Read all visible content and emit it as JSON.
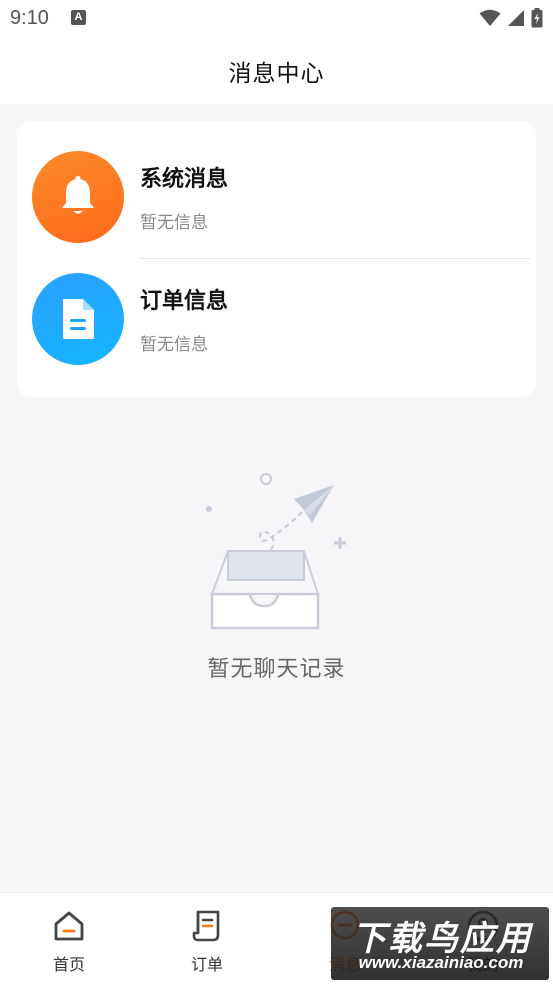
{
  "status_bar": {
    "time": "9:10",
    "notification_badge": "A",
    "icons": [
      "wifi-icon",
      "signal-icon",
      "battery-charging-icon"
    ]
  },
  "header": {
    "title": "消息中心"
  },
  "messages": [
    {
      "title": "系统消息",
      "subtitle": "暂无信息",
      "icon": "bell-icon",
      "color": "#fd7420"
    },
    {
      "title": "订单信息",
      "subtitle": "暂无信息",
      "icon": "document-icon",
      "color": "#1aa6ff"
    }
  ],
  "empty_state": {
    "text": "暂无聊天记录",
    "icon": "empty-inbox-paper-plane-icon"
  },
  "bottom_nav": {
    "items": [
      {
        "label": "首页",
        "icon": "home-icon"
      },
      {
        "label": "订单",
        "icon": "order-icon"
      },
      {
        "label": "消息",
        "icon": "message-icon",
        "active": true
      },
      {
        "label": "我的",
        "icon": "profile-icon"
      }
    ],
    "active_color": "#ff7a1a"
  },
  "watermark": {
    "main": "下载鸟应用",
    "url": "www.xiazainiao.com"
  }
}
